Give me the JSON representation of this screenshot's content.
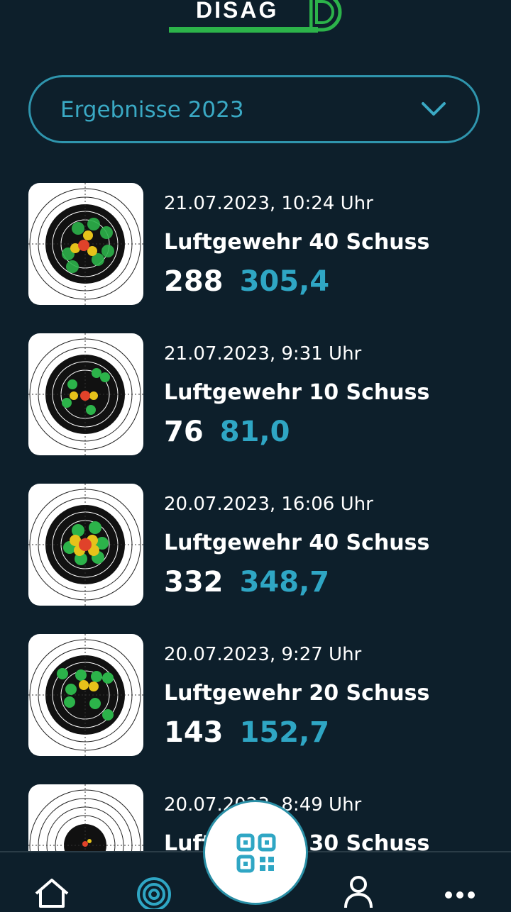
{
  "brand": {
    "logo_text": "DISAG"
  },
  "filter": {
    "selected": "Ergebnisse 2023"
  },
  "results": [
    {
      "datetime": "21.07.2023, 10:24 Uhr",
      "discipline": "Luftgewehr 40 Schuss",
      "score_integer": "288",
      "score_decimal": "305,4"
    },
    {
      "datetime": "21.07.2023, 9:31 Uhr",
      "discipline": "Luftgewehr 10 Schuss",
      "score_integer": "76",
      "score_decimal": "81,0"
    },
    {
      "datetime": "20.07.2023, 16:06 Uhr",
      "discipline": "Luftgewehr 40 Schuss",
      "score_integer": "332",
      "score_decimal": "348,7"
    },
    {
      "datetime": "20.07.2023, 9:27 Uhr",
      "discipline": "Luftgewehr 20 Schuss",
      "score_integer": "143",
      "score_decimal": "152,7"
    },
    {
      "datetime": "20.07.2023, 8:49 Uhr",
      "discipline": "Luftgewehr 30 Schuss",
      "score_integer": "",
      "score_decimal": ""
    }
  ],
  "nav": {
    "items": [
      {
        "icon": "home-icon"
      },
      {
        "icon": "target-icon",
        "active": true
      },
      {
        "icon": "qr-scan-icon"
      },
      {
        "icon": "profile-icon"
      },
      {
        "icon": "more-icon"
      }
    ]
  },
  "colors": {
    "background": "#0d1f2b",
    "accent": "#2fa6c4",
    "brand_green": "#2cb34a"
  }
}
